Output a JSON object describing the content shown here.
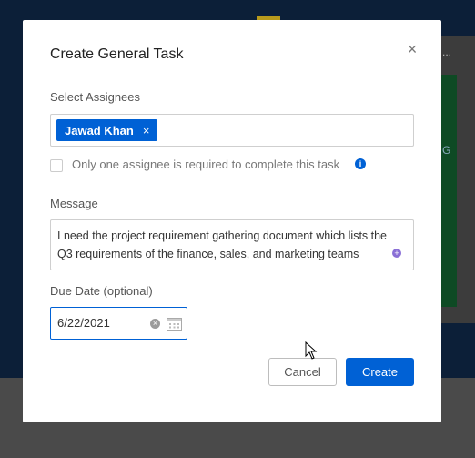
{
  "modal": {
    "title": "Create General Task",
    "close_icon": "×"
  },
  "assignees": {
    "label": "Select Assignees",
    "selected": [
      {
        "name": "Jawad Khan",
        "remove_icon": "×"
      }
    ]
  },
  "completion_rule": {
    "label": "Only one assignee is required to complete this task",
    "checked": false,
    "info_icon": "i"
  },
  "message": {
    "label": "Message",
    "value": "I need the project requirement gathering document which lists the Q3 requirements of the finance, sales, and marketing teams"
  },
  "due_date": {
    "label": "Due Date (optional)",
    "value": "6/22/2021",
    "clear_icon": "×"
  },
  "buttons": {
    "cancel": "Cancel",
    "create": "Create"
  },
  "background": {
    "dots": "...",
    "g_letter": "G"
  },
  "colors": {
    "accent": "#0061d5"
  }
}
